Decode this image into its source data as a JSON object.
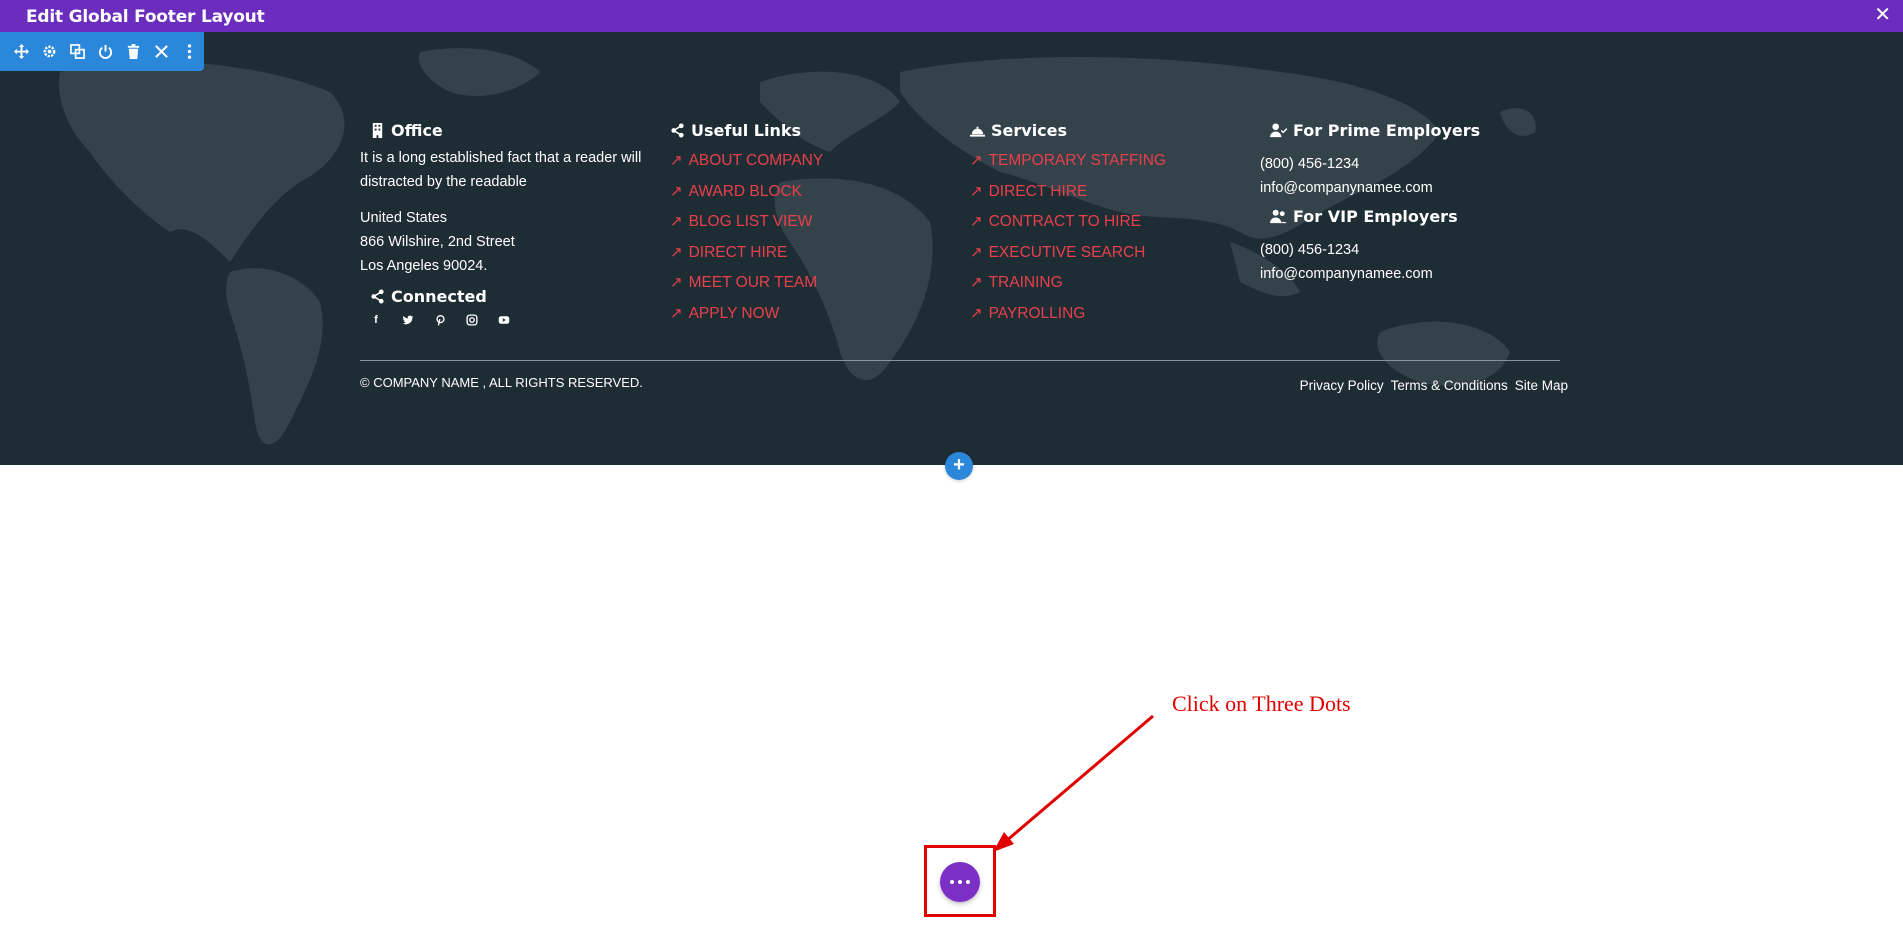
{
  "topbar": {
    "title": "Edit Global Footer Layout",
    "close_icon": "close-icon"
  },
  "toolbar": {
    "icons": [
      "move-icon",
      "gear-icon",
      "duplicate-icon",
      "power-icon",
      "trash-icon",
      "close-icon",
      "kebab-icon"
    ]
  },
  "office": {
    "heading": "Office",
    "description": "It is a long established fact that a reader will distracted by the readable",
    "address_line1": "United States",
    "address_line2": "866 Wilshire, 2nd Street",
    "address_line3": "Los Angeles 90024.",
    "connected_heading": "Connected",
    "social": [
      "f",
      "t",
      "p",
      "ig",
      "yt"
    ]
  },
  "useful_links": {
    "heading": "Useful Links",
    "items": [
      "ABOUT COMPANY",
      "AWARD BLOCK",
      "BLOG LIST VIEW",
      "DIRECT HIRE",
      "MEET OUR TEAM",
      "APPLY NOW"
    ]
  },
  "services": {
    "heading": "Services",
    "items": [
      "TEMPORARY STAFFING",
      "DIRECT HIRE",
      "CONTRACT TO HIRE",
      "EXECUTIVE SEARCH",
      "TRAINING",
      "PAYROLLING"
    ]
  },
  "employers": {
    "prime_heading": "For Prime Employers",
    "prime_phone": "(800) 456-1234",
    "prime_email": "info@companynamee.com",
    "vip_heading": "For VIP Employers",
    "vip_phone": "(800) 456-1234",
    "vip_email": "info@companynamee.com"
  },
  "bottom": {
    "copyright": "© COMPANY NAME , ALL RIGHTS RESERVED.",
    "privacy": "Privacy Policy",
    "terms": "Terms & Conditions",
    "sitemap": "Site Map"
  },
  "add_button": "+",
  "annotation": {
    "text": "Click on Three Dots"
  },
  "colors": {
    "topbar": "#6b2dbd",
    "footer_bg": "#1e2c34",
    "link": "#e8404b",
    "toolbar": "#2b87da",
    "dots_button": "#7c2fc5",
    "annotation": "#e00000"
  }
}
